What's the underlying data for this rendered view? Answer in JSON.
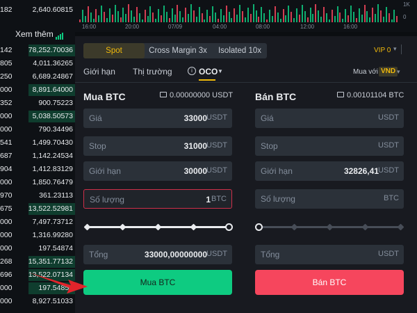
{
  "order_book": {
    "top_price": "182",
    "top_qty": "2,640.60815",
    "see_more_label": "Xem thêm",
    "rows": [
      {
        "price": "142",
        "qty": "78,252.70036",
        "fill": 0.62
      },
      {
        "price": "805",
        "qty": "4,011.36265",
        "fill": 0.0
      },
      {
        "price": "250",
        "qty": "6,689.24867",
        "fill": 0.0
      },
      {
        "price": "000",
        "qty": "8,891.64000",
        "fill": 0.62
      },
      {
        "price": "352",
        "qty": "900.75223",
        "fill": 0.0
      },
      {
        "price": "000",
        "qty": "5,038.50573",
        "fill": 0.62
      },
      {
        "price": "000",
        "qty": "790.34496",
        "fill": 0.0
      },
      {
        "price": "541",
        "qty": "1,499.70430",
        "fill": 0.0
      },
      {
        "price": "687",
        "qty": "1,142.24534",
        "fill": 0.0
      },
      {
        "price": "904",
        "qty": "1,412.83129",
        "fill": 0.0
      },
      {
        "price": "000",
        "qty": "1,850.76479",
        "fill": 0.0
      },
      {
        "price": "970",
        "qty": "361.23113",
        "fill": 0.0
      },
      {
        "price": "675",
        "qty": "13,522.52981",
        "fill": 0.62
      },
      {
        "price": "000",
        "qty": "7,497.73712",
        "fill": 0.0
      },
      {
        "price": "000",
        "qty": "1,316.99280",
        "fill": 0.0
      },
      {
        "price": "000",
        "qty": "197.54874",
        "fill": 0.0
      },
      {
        "price": "268",
        "qty": "15,351.77132",
        "fill": 0.62
      },
      {
        "price": "696",
        "qty": "13,522.07134",
        "fill": 0.62
      },
      {
        "price": "000",
        "qty": "197.54850",
        "fill": 0.62
      },
      {
        "price": "000",
        "qty": "8,927.51033",
        "fill": 0.0
      }
    ]
  },
  "chart": {
    "times": [
      "16:00",
      "20:00",
      "07/09",
      "04:00",
      "08:00",
      "12:00",
      "16:00"
    ],
    "axis_labels": [
      "1K",
      "0"
    ],
    "up_color": "#0ecb81",
    "down_color": "#f6465d"
  },
  "panel": {
    "type_tabs": [
      {
        "label": "Spot",
        "active": true
      },
      {
        "label": "Cross Margin 3x",
        "active": false
      },
      {
        "label": "Isolated 10x",
        "active": false
      }
    ],
    "vip": "VIP 0",
    "order_tabs": {
      "limit": "Giới hạn",
      "market": "Thị trường",
      "oco": "OCO"
    },
    "buy_with_label": "Mua với",
    "buy_with_currency": "VND",
    "buy": {
      "title": "Mua BTC",
      "balance": "0.00000000 USDT",
      "price_label": "Giá",
      "price_value": "33000",
      "price_unit": "USDT",
      "stop_label": "Stop",
      "stop_value": "31000",
      "stop_unit": "USDT",
      "limit_label": "Giới hạn",
      "limit_value": "30000",
      "limit_unit": "USDT",
      "amount_label": "Số lượng",
      "amount_value": "1",
      "amount_unit": "BTC",
      "slider_level": 1.0,
      "total_label": "Tổng",
      "total_value": "33000,00000000",
      "total_unit": "USDT",
      "button": "Mua BTC"
    },
    "sell": {
      "title": "Bán BTC",
      "balance": "0.00101104 BTC",
      "price_label": "Giá",
      "price_unit": "USDT",
      "stop_label": "Stop",
      "stop_unit": "USDT",
      "limit_label": "Giới hạn",
      "limit_value": "32826,41",
      "limit_unit": "USDT",
      "amount_label": "Số lượng",
      "amount_unit": "BTC",
      "slider_level": 0.0,
      "total_label": "Tổng",
      "total_unit": "USDT",
      "button": "Bán BTC"
    }
  }
}
